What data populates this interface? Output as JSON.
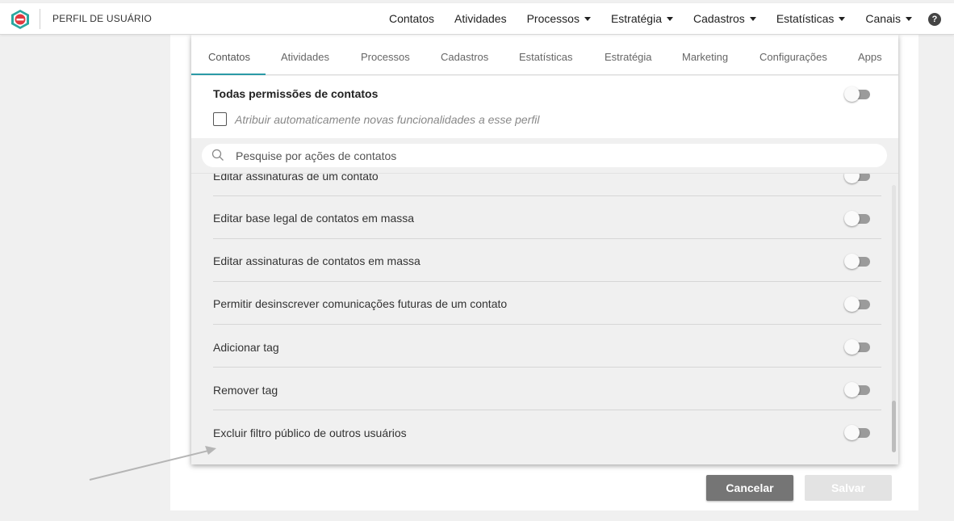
{
  "header": {
    "page_title": "PERFIL DE USUÁRIO",
    "nav": [
      {
        "label": "Contatos",
        "dropdown": false
      },
      {
        "label": "Atividades",
        "dropdown": false
      },
      {
        "label": "Processos",
        "dropdown": true
      },
      {
        "label": "Estratégia",
        "dropdown": true
      },
      {
        "label": "Cadastros",
        "dropdown": true
      },
      {
        "label": "Estatísticas",
        "dropdown": true
      },
      {
        "label": "Canais",
        "dropdown": true
      }
    ],
    "help_label": "?"
  },
  "tabs": [
    "Contatos",
    "Atividades",
    "Processos",
    "Cadastros",
    "Estatísticas",
    "Estratégia",
    "Marketing",
    "Configurações",
    "Apps"
  ],
  "active_tab": "Contatos",
  "all_permissions": {
    "title": "Todas permissões de contatos",
    "enabled": false,
    "auto_assign_label": "Atribuir automaticamente novas funcionalidades a esse perfil",
    "auto_assign_checked": false
  },
  "search": {
    "placeholder": "Pesquise por ações de contatos",
    "value": ""
  },
  "permissions": [
    {
      "label": "Editar assinaturas de um contato",
      "enabled": false
    },
    {
      "label": "Editar base legal de contatos em massa",
      "enabled": false
    },
    {
      "label": "Editar assinaturas de contatos em massa",
      "enabled": false
    },
    {
      "label": "Permitir desinscrever comunicações futuras de um contato",
      "enabled": false
    },
    {
      "label": "Adicionar tag",
      "enabled": false
    },
    {
      "label": "Remover tag",
      "enabled": false
    },
    {
      "label": "Excluir filtro público de outros usuários",
      "enabled": false
    }
  ],
  "buttons": {
    "cancel": "Cancelar",
    "save": "Salvar"
  },
  "colors": {
    "accent": "#2a9aa6",
    "logo_red": "#e2383f",
    "cancel_bg": "#757575",
    "save_bg_disabled": "#e3e3e3"
  }
}
